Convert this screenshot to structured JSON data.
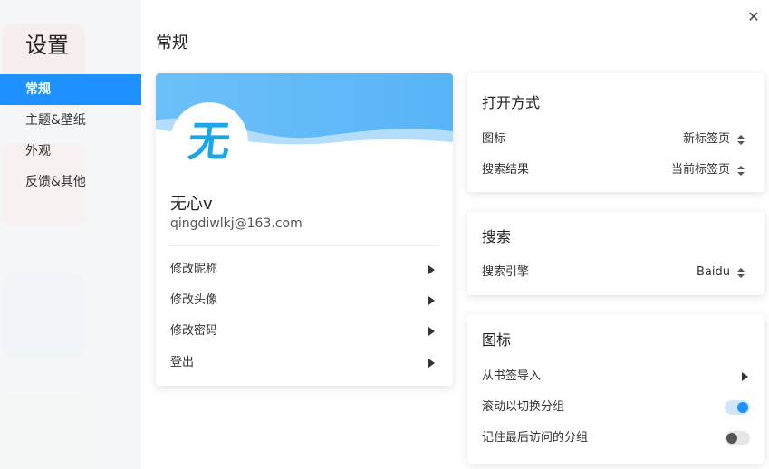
{
  "sidebar": {
    "title": "设置",
    "items": [
      {
        "label": "常规",
        "active": true
      },
      {
        "label": "主题&壁纸",
        "active": false
      },
      {
        "label": "外观",
        "active": false
      },
      {
        "label": "反馈&其他",
        "active": false
      }
    ]
  },
  "main": {
    "title": "常规",
    "close_icon": "close-icon"
  },
  "profile": {
    "avatar_text": "无",
    "name": "无心v",
    "email": "qingdiwlkj@163.com",
    "menu": [
      {
        "label": "修改昵称"
      },
      {
        "label": "修改头像"
      },
      {
        "label": "修改密码"
      },
      {
        "label": "登出"
      }
    ]
  },
  "open_mode": {
    "title": "打开方式",
    "rows": [
      {
        "label": "图标",
        "value": "新标签页"
      },
      {
        "label": "搜索结果",
        "value": "当前标签页"
      }
    ]
  },
  "search": {
    "title": "搜索",
    "rows": [
      {
        "label": "搜索引擎",
        "value": "Baidu"
      }
    ]
  },
  "icons": {
    "title": "图标",
    "import_label": "从书签导入",
    "scroll_switch_label": "滚动以切换分组",
    "scroll_switch_on": true,
    "remember_group_label": "记住最后访问的分组",
    "remember_group_on": false
  },
  "colors": {
    "accent": "#1e90ff",
    "header_gradient_top": "#62baf8",
    "header_gradient_bottom": "#9fd3fb"
  }
}
